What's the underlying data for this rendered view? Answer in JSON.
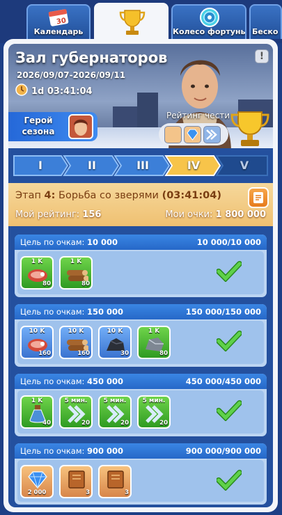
{
  "tabs": [
    {
      "label": "Календарь",
      "icon": "calendar-icon",
      "badge": "30"
    },
    {
      "label": "",
      "icon": "trophy-icon",
      "active": true
    },
    {
      "label": "Колесо фортуны",
      "icon": "fortune-wheel-icon"
    },
    {
      "label": "Беско",
      "icon": "more-tab"
    }
  ],
  "event": {
    "title": "Зал губернаторов",
    "dates": "2026/09/07-2026/09/11",
    "timer": "1d 03:41:04",
    "info_label": "!",
    "hero_season": "Герой сезона",
    "honor_rating": "Рейтинг чести"
  },
  "stages": [
    "I",
    "II",
    "III",
    "IV",
    "V"
  ],
  "active_stage": 3,
  "stage_info": {
    "prefix": "Этап",
    "number": "4:",
    "name": "Борьба со зверями",
    "time": "(03:41:04)",
    "rating_label": "Мой рейтинг:",
    "rating_value": "156",
    "points_label": "Мои очки:",
    "points_value": "1 800 000"
  },
  "goals": [
    {
      "label": "Цель по очкам:",
      "target": "10 000",
      "progress": "10 000/10 000",
      "completed": true,
      "rewards": [
        {
          "icon": "meat-icon",
          "qty": "1 K",
          "count": "80",
          "color": "green"
        },
        {
          "icon": "wood-icon",
          "qty": "1 K",
          "count": "80",
          "color": "green"
        }
      ]
    },
    {
      "label": "Цель по очкам:",
      "target": "150 000",
      "progress": "150 000/150 000",
      "completed": true,
      "rewards": [
        {
          "icon": "meat-icon",
          "qty": "10 K",
          "count": "160",
          "color": "blue"
        },
        {
          "icon": "wood-icon",
          "qty": "10 K",
          "count": "160",
          "color": "blue"
        },
        {
          "icon": "coal-icon",
          "qty": "10 K",
          "count": "30",
          "color": "blue"
        },
        {
          "icon": "iron-icon",
          "qty": "1 K",
          "count": "80",
          "color": "green"
        }
      ]
    },
    {
      "label": "Цель по очкам:",
      "target": "450 000",
      "progress": "450 000/450 000",
      "completed": true,
      "rewards": [
        {
          "icon": "potion-icon",
          "qty": "1 K",
          "count": "40",
          "color": "green"
        },
        {
          "icon": "speedup-icon",
          "qty": "5 мин.",
          "count": "20",
          "color": "green"
        },
        {
          "icon": "speedup-icon",
          "qty": "5 мин.",
          "count": "20",
          "color": "green"
        },
        {
          "icon": "speedup-icon",
          "qty": "5 мин.",
          "count": "20",
          "color": "green"
        }
      ]
    },
    {
      "label": "Цель по очкам:",
      "target": "900 000",
      "progress": "900 000/900 000",
      "completed": true,
      "rewards": [
        {
          "icon": "gem-icon",
          "qty": "",
          "count": "2 000",
          "color": "orange"
        },
        {
          "icon": "manual-icon",
          "qty": "",
          "count": "3",
          "color": "orange"
        },
        {
          "icon": "manual-icon",
          "qty": "",
          "count": "3",
          "color": "orange"
        }
      ]
    }
  ],
  "colors": {
    "accent": "#2668c8",
    "stage_active": "#f7c44a",
    "check": "#3aa82a",
    "header": "#efc071"
  }
}
